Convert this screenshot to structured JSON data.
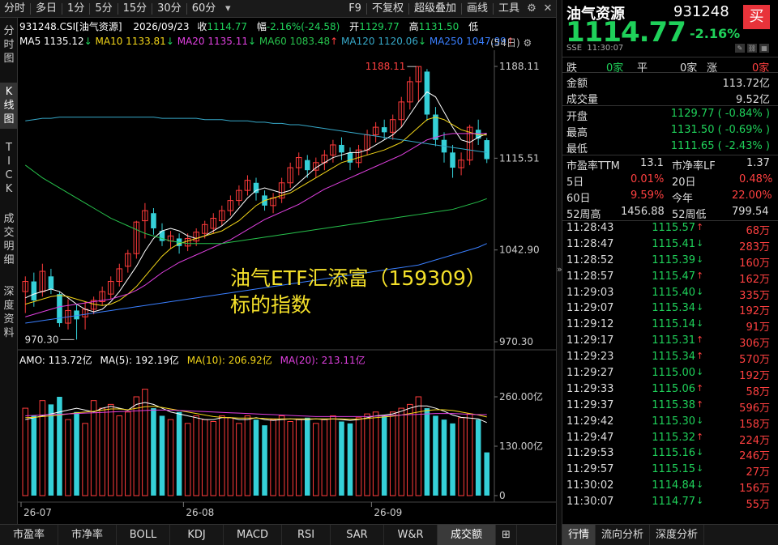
{
  "toolbar": {
    "items": [
      "分时",
      "多日",
      "1分",
      "5分",
      "15分",
      "30分",
      "60分"
    ],
    "right_items": [
      "F9",
      "不复权",
      "超级叠加",
      "画线",
      "工具"
    ]
  },
  "left_tabs": [
    "分时图",
    "K线图",
    "TICK",
    "成交明细",
    "深度资料"
  ],
  "info": {
    "code": "931248.CSI[油气资源]",
    "date": "2026/09/23",
    "close_label": "收",
    "close": "1114.77",
    "range_label": "幅",
    "range": "-2.16%(-24.58)",
    "open_label": "开",
    "open": "1129.77",
    "high_label": "高",
    "high": "1131.50",
    "low_label": "低"
  },
  "ma": {
    "ma5": "MA5 1135.12",
    "ma10": "MA10 1133.81",
    "ma20": "MA20 1135.11",
    "ma60": "MA60 1083.48",
    "ma120": "MA120 1120.06",
    "ma250": "MA250 1047.99",
    "period": "(54日)"
  },
  "amo": {
    "amo": "AMO: 113.72亿",
    "ma5": "MA(5): 192.19亿",
    "ma10": "MA(10): 206.92亿",
    "ma20": "MA(20): 213.11亿"
  },
  "overlay": {
    "line1": "油气ETF汇添富（159309）",
    "line2": "标的指数"
  },
  "chart_data": {
    "type": "candlestick",
    "price_axis": {
      "labels": [
        "1188.11",
        "1115.51",
        "1042.90",
        "970.30"
      ],
      "min": 970.3,
      "max": 1188.11
    },
    "volume_axis": {
      "labels": [
        "260.00亿",
        "130.00亿",
        "0"
      ]
    },
    "x_labels": [
      "26-07",
      "26-08",
      "26-09"
    ],
    "annotations": {
      "high": "1188.11",
      "low": "970.30"
    },
    "candles": [
      [
        1010,
        1018,
        993,
        1022
      ],
      [
        1018,
        1003,
        998,
        1025
      ],
      [
        1010,
        1026,
        1006,
        1032
      ],
      [
        1022,
        1012,
        1008,
        1028
      ],
      [
        1008,
        985,
        982,
        1010
      ],
      [
        985,
        995,
        980,
        1004
      ],
      [
        995,
        988,
        972,
        1000
      ],
      [
        990,
        996,
        980,
        1002
      ],
      [
        996,
        1003,
        992,
        1006
      ],
      [
        1002,
        1010,
        999,
        1014
      ],
      [
        1008,
        1018,
        1004,
        1022
      ],
      [
        1018,
        1028,
        1014,
        1032
      ],
      [
        1030,
        1040,
        1025,
        1043
      ],
      [
        1040,
        1065,
        1036,
        1066
      ],
      [
        1066,
        1074,
        1052,
        1080
      ],
      [
        1072,
        1060,
        1055,
        1076
      ],
      [
        1058,
        1050,
        1046,
        1064
      ],
      [
        1050,
        1054,
        1044,
        1058
      ],
      [
        1052,
        1046,
        1040,
        1056
      ],
      [
        1046,
        1052,
        1042,
        1056
      ],
      [
        1050,
        1057,
        1046,
        1060
      ],
      [
        1056,
        1063,
        1052,
        1066
      ],
      [
        1060,
        1068,
        1056,
        1072
      ],
      [
        1066,
        1074,
        1062,
        1078
      ],
      [
        1074,
        1082,
        1070,
        1086
      ],
      [
        1082,
        1090,
        1078,
        1094
      ],
      [
        1090,
        1098,
        1086,
        1102
      ],
      [
        1096,
        1088,
        1082,
        1100
      ],
      [
        1086,
        1078,
        1074,
        1090
      ],
      [
        1078,
        1084,
        1072,
        1088
      ],
      [
        1084,
        1096,
        1080,
        1100
      ],
      [
        1096,
        1108,
        1092,
        1112
      ],
      [
        1108,
        1116,
        1102,
        1120
      ],
      [
        1114,
        1106,
        1100,
        1118
      ],
      [
        1106,
        1112,
        1100,
        1116
      ],
      [
        1112,
        1118,
        1106,
        1122
      ],
      [
        1118,
        1126,
        1112,
        1130
      ],
      [
        1126,
        1120,
        1114,
        1132
      ],
      [
        1120,
        1112,
        1106,
        1124
      ],
      [
        1112,
        1122,
        1108,
        1126
      ],
      [
        1122,
        1134,
        1118,
        1138
      ],
      [
        1134,
        1140,
        1128,
        1144
      ],
      [
        1140,
        1136,
        1130,
        1146
      ],
      [
        1136,
        1146,
        1130,
        1150
      ],
      [
        1146,
        1160,
        1140,
        1164
      ],
      [
        1160,
        1176,
        1154,
        1180
      ],
      [
        1176,
        1188,
        1160,
        1188
      ],
      [
        1184,
        1150,
        1145,
        1186
      ],
      [
        1150,
        1130,
        1125,
        1156
      ],
      [
        1130,
        1120,
        1112,
        1136
      ],
      [
        1120,
        1108,
        1100,
        1126
      ],
      [
        1108,
        1114,
        1102,
        1120
      ],
      [
        1114,
        1140,
        1110,
        1142
      ],
      [
        1138,
        1131,
        1126,
        1146
      ],
      [
        1129.77,
        1114.77,
        1111.65,
        1131.5
      ]
    ],
    "ma_lines": {
      "ma5": [
        1005,
        1008,
        1010,
        1012,
        1010,
        1005,
        1000,
        996,
        994,
        996,
        1002,
        1010,
        1020,
        1030,
        1042,
        1052,
        1058,
        1060,
        1058,
        1054,
        1052,
        1054,
        1058,
        1062,
        1068,
        1076,
        1084,
        1090,
        1092,
        1090,
        1088,
        1090,
        1096,
        1102,
        1108,
        1112,
        1116,
        1118,
        1120,
        1120,
        1122,
        1126,
        1130,
        1134,
        1140,
        1150,
        1160,
        1168,
        1164,
        1152,
        1140,
        1130,
        1128,
        1132,
        1135
      ],
      "ma10": [
        1000,
        1002,
        1004,
        1006,
        1007,
        1006,
        1004,
        1002,
        1000,
        999,
        1000,
        1003,
        1008,
        1014,
        1022,
        1030,
        1038,
        1044,
        1048,
        1050,
        1052,
        1054,
        1056,
        1058,
        1062,
        1066,
        1072,
        1078,
        1082,
        1084,
        1086,
        1088,
        1092,
        1096,
        1100,
        1104,
        1108,
        1112,
        1114,
        1116,
        1118,
        1120,
        1122,
        1125,
        1128,
        1134,
        1140,
        1146,
        1148,
        1146,
        1142,
        1138,
        1136,
        1134,
        1133.81
      ],
      "ma20": [
        990,
        992,
        994,
        996,
        998,
        999,
        1000,
        1001,
        1002,
        1003,
        1004,
        1006,
        1008,
        1011,
        1015,
        1020,
        1025,
        1029,
        1033,
        1036,
        1039,
        1042,
        1045,
        1048,
        1051,
        1055,
        1059,
        1063,
        1067,
        1070,
        1073,
        1076,
        1079,
        1083,
        1087,
        1091,
        1094,
        1097,
        1100,
        1103,
        1106,
        1109,
        1112,
        1115,
        1118,
        1122,
        1126,
        1130,
        1132,
        1134,
        1135,
        1135,
        1135,
        1135,
        1135.11
      ],
      "ma60": [
        1110,
        1105,
        1100,
        1096,
        1092,
        1088,
        1084,
        1080,
        1076,
        1072,
        1068,
        1065,
        1062,
        1059,
        1056,
        1054,
        1052,
        1050,
        1049,
        1048,
        1048,
        1048,
        1048,
        1048,
        1049,
        1050,
        1051,
        1052,
        1053,
        1054,
        1055,
        1056,
        1057,
        1058,
        1059,
        1060,
        1061,
        1062,
        1063,
        1064,
        1065,
        1066,
        1067,
        1068,
        1069,
        1070,
        1071,
        1072,
        1073,
        1074,
        1075,
        1077,
        1079,
        1081,
        1083.48
      ],
      "ma120": [
        1145,
        1146,
        1147,
        1147,
        1148,
        1148,
        1148,
        1148,
        1148,
        1148,
        1148,
        1148,
        1148,
        1148,
        1148,
        1148,
        1147,
        1147,
        1147,
        1147,
        1147,
        1146,
        1146,
        1146,
        1145,
        1145,
        1145,
        1144,
        1144,
        1143,
        1143,
        1142,
        1142,
        1141,
        1140,
        1139,
        1138,
        1137,
        1136,
        1135,
        1134,
        1133,
        1132,
        1131,
        1130,
        1129,
        1128,
        1127,
        1126,
        1125,
        1124,
        1123,
        1122,
        1121,
        1120.06
      ],
      "ma250": [
        985,
        986,
        987,
        988,
        989,
        990,
        991,
        992,
        993,
        994,
        995,
        996,
        997,
        998,
        999,
        1000,
        1001,
        1002,
        1003,
        1004,
        1005,
        1006,
        1007,
        1008,
        1009,
        1010,
        1011,
        1012,
        1013,
        1014,
        1015,
        1016,
        1017,
        1018,
        1019,
        1020,
        1021,
        1022,
        1023,
        1024,
        1025,
        1026,
        1027,
        1028,
        1029,
        1030,
        1031,
        1033,
        1035,
        1037,
        1039,
        1041,
        1043,
        1045,
        1047.99
      ]
    },
    "volume": [
      230,
      210,
      250,
      240,
      260,
      200,
      220,
      190,
      250,
      230,
      240,
      210,
      220,
      260,
      280,
      230,
      210,
      200,
      220,
      190,
      210,
      200,
      195,
      210,
      205,
      190,
      210,
      200,
      185,
      200,
      210,
      195,
      200,
      205,
      190,
      200,
      210,
      195,
      190,
      205,
      215,
      220,
      210,
      220,
      230,
      240,
      260,
      230,
      210,
      200,
      190,
      205,
      215,
      200,
      113.72
    ],
    "amo_ma5": [
      200,
      205,
      210,
      215,
      220,
      225,
      230,
      225,
      220,
      230,
      235,
      230,
      225,
      240,
      245,
      240,
      230,
      220,
      215,
      210,
      205,
      200,
      200,
      205,
      205,
      200,
      200,
      205,
      200,
      198,
      200,
      202,
      200,
      200,
      202,
      200,
      202,
      200,
      198,
      200,
      205,
      210,
      212,
      215,
      222,
      230,
      236,
      236,
      230,
      222,
      212,
      206,
      204,
      202,
      192.19
    ],
    "amo_ma10": [
      205,
      206,
      208,
      210,
      212,
      215,
      218,
      220,
      222,
      225,
      228,
      228,
      226,
      230,
      234,
      235,
      232,
      228,
      224,
      220,
      216,
      212,
      208,
      206,
      205,
      204,
      204,
      204,
      203,
      202,
      202,
      202,
      202,
      202,
      202,
      202,
      202,
      202,
      201,
      201,
      203,
      205,
      207,
      209,
      212,
      216,
      220,
      224,
      226,
      226,
      224,
      220,
      216,
      212,
      206.92
    ],
    "amo_ma20": [
      210,
      211,
      212,
      213,
      214,
      215,
      216,
      217,
      218,
      219,
      220,
      221,
      222,
      223,
      224,
      225,
      225,
      225,
      224,
      223,
      222,
      221,
      220,
      219,
      218,
      217,
      216,
      215,
      214,
      213,
      212,
      211,
      210,
      209,
      208,
      208,
      208,
      208,
      208,
      208,
      208,
      209,
      210,
      211,
      212,
      213,
      214,
      215,
      216,
      216,
      216,
      215,
      214,
      213,
      213.11
    ]
  },
  "bottom_tabs": [
    "市盈率",
    "市净率",
    "BOLL",
    "KDJ",
    "MACD",
    "RSI",
    "SAR",
    "W&R",
    "成交额"
  ],
  "right": {
    "name": "油气资源",
    "code": "931248",
    "buy_label": "买",
    "price": "1114.77",
    "pct": "-2.16%",
    "exchange": "SSE",
    "time": "11:30:07",
    "breadth": {
      "down_label": "跌",
      "down_val": "0家",
      "flat_label": "平",
      "flat_val": "0家",
      "up_label": "涨",
      "up_val": "0家"
    },
    "stats": [
      {
        "label": "金额",
        "value": "113.72亿"
      },
      {
        "label": "成交量",
        "value": "9.52亿"
      },
      {
        "label": "开盘",
        "value": "1129.77 ( -0.84% )"
      },
      {
        "label": "最高",
        "value": "1131.50 ( -0.69% )"
      },
      {
        "label": "最低",
        "value": "1111.65 ( -2.43% )"
      }
    ],
    "quote": [
      {
        "l1": "市盈率TTM",
        "v1": "13.1",
        "l2": "市净率LF",
        "v2": "1.37"
      },
      {
        "l1": "5日",
        "v1": "0.01%",
        "l2": "20日",
        "v2": "0.48%"
      },
      {
        "l1": "60日",
        "v1": "9.59%",
        "l2": "今年",
        "v2": "22.00%"
      },
      {
        "l1": "52周高",
        "v1": "1456.88",
        "l2": "52周低",
        "v2": "799.54"
      }
    ],
    "ticks": [
      {
        "time": "11:28:43",
        "price": "1115.57",
        "dir": "up",
        "vol": "68万"
      },
      {
        "time": "11:28:47",
        "price": "1115.41",
        "dir": "down",
        "vol": "283万"
      },
      {
        "time": "11:28:52",
        "price": "1115.39",
        "dir": "down",
        "vol": "160万"
      },
      {
        "time": "11:28:57",
        "price": "1115.47",
        "dir": "up",
        "vol": "162万"
      },
      {
        "time": "11:29:03",
        "price": "1115.40",
        "dir": "down",
        "vol": "335万"
      },
      {
        "time": "11:29:07",
        "price": "1115.34",
        "dir": "down",
        "vol": "192万"
      },
      {
        "time": "11:29:12",
        "price": "1115.14",
        "dir": "down",
        "vol": "91万"
      },
      {
        "time": "11:29:17",
        "price": "1115.31",
        "dir": "up",
        "vol": "306万"
      },
      {
        "time": "11:29:23",
        "price": "1115.34",
        "dir": "up",
        "vol": "570万"
      },
      {
        "time": "11:29:27",
        "price": "1115.00",
        "dir": "down",
        "vol": "192万"
      },
      {
        "time": "11:29:33",
        "price": "1115.06",
        "dir": "up",
        "vol": "58万"
      },
      {
        "time": "11:29:37",
        "price": "1115.38",
        "dir": "up",
        "vol": "596万"
      },
      {
        "time": "11:29:42",
        "price": "1115.30",
        "dir": "down",
        "vol": "158万"
      },
      {
        "time": "11:29:47",
        "price": "1115.32",
        "dir": "up",
        "vol": "224万"
      },
      {
        "time": "11:29:53",
        "price": "1115.16",
        "dir": "down",
        "vol": "246万"
      },
      {
        "time": "11:29:57",
        "price": "1115.15",
        "dir": "down",
        "vol": "27万"
      },
      {
        "time": "11:30:02",
        "price": "1114.84",
        "dir": "down",
        "vol": "156万"
      },
      {
        "time": "11:30:07",
        "price": "1114.77",
        "dir": "down",
        "vol": "55万"
      }
    ],
    "tabs": [
      "行情",
      "流向分析",
      "深度分析"
    ]
  },
  "colors": {
    "up": "#ff4040",
    "down": "#1fd15a",
    "candle_down": "#35d0d8",
    "bg": "#000000"
  }
}
